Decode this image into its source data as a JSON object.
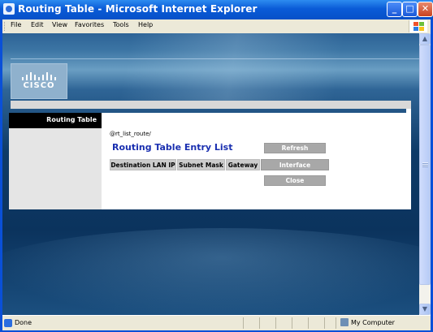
{
  "window": {
    "title": "Routing Table - Microsoft Internet Explorer",
    "controls": {
      "minimize": "_",
      "maximize": "□",
      "close": "✕"
    }
  },
  "menu": {
    "items": [
      "File",
      "Edit",
      "View",
      "Favorites",
      "Tools",
      "Help"
    ]
  },
  "brand": {
    "logo_text": "CISCO"
  },
  "sidebar": {
    "active_item": "Routing Table"
  },
  "main": {
    "template_var": "@rt_list_route/",
    "title": "Routing Table Entry List",
    "refresh_button": "Refresh",
    "close_button": "Close",
    "table_headers": [
      "Destination LAN IP",
      "Subnet Mask",
      "Gateway",
      "Interface"
    ]
  },
  "scrollbar": {
    "up": "▲",
    "down": "▼"
  },
  "status": {
    "text": "Done",
    "zone": "My Computer"
  },
  "colors": {
    "title_blue": "#1a2fb0",
    "xp_blue": "#0a5bd7",
    "button_gray": "#a8a8a8"
  }
}
